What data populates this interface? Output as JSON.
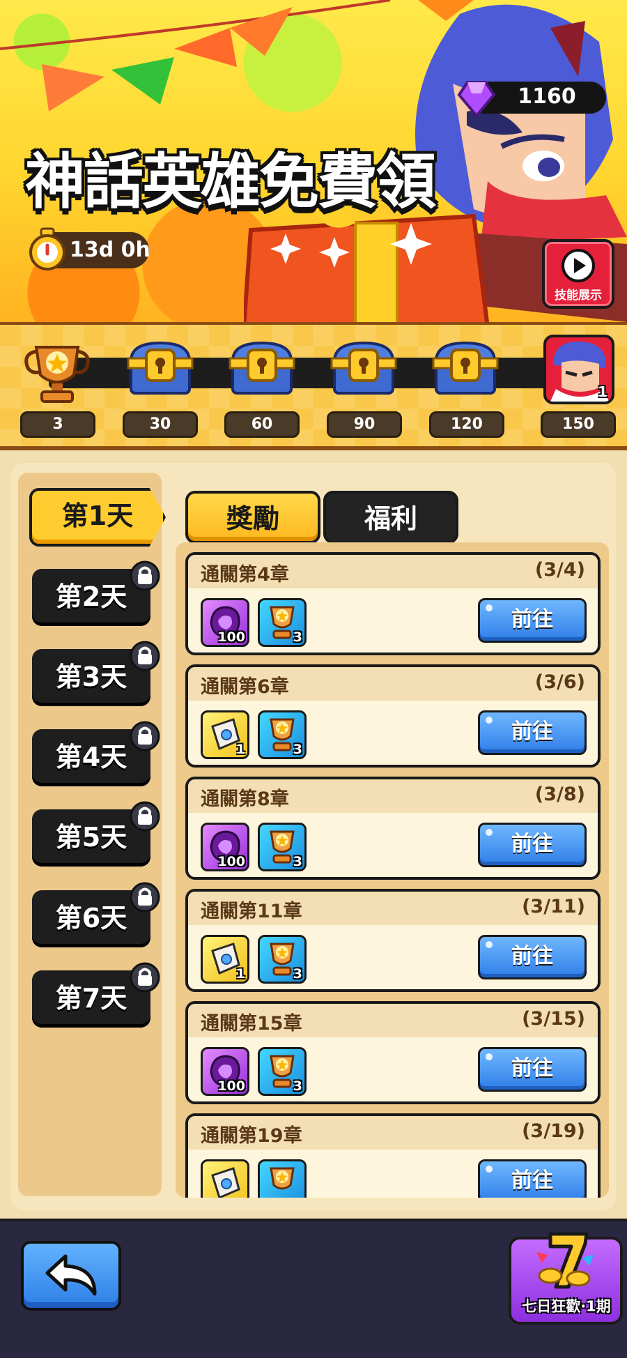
{
  "header": {
    "title": "神話英雄免費領",
    "gems": "1160",
    "timer": "13d 0h",
    "skill_button_label": "技能展示"
  },
  "progress": {
    "milestones": [
      {
        "value": "3",
        "icon": "trophy-icon"
      },
      {
        "value": "30",
        "icon": "chest-icon"
      },
      {
        "value": "60",
        "icon": "chest-icon"
      },
      {
        "value": "90",
        "icon": "chest-icon"
      },
      {
        "value": "120",
        "icon": "chest-icon"
      },
      {
        "value": "150",
        "icon": "hero-portrait-icon",
        "badge": "1"
      }
    ]
  },
  "days": [
    {
      "label": "第1天",
      "active": true,
      "locked": false
    },
    {
      "label": "第2天",
      "active": false,
      "locked": true
    },
    {
      "label": "第3天",
      "active": false,
      "locked": true
    },
    {
      "label": "第4天",
      "active": false,
      "locked": true
    },
    {
      "label": "第5天",
      "active": false,
      "locked": true
    },
    {
      "label": "第6天",
      "active": false,
      "locked": true
    },
    {
      "label": "第7天",
      "active": false,
      "locked": true
    }
  ],
  "tabs": {
    "reward": "獎勵",
    "bonus": "福利"
  },
  "tasks": [
    {
      "title": "通關第4章",
      "progress": "(3/4)",
      "rewards": [
        {
          "type": "purple",
          "icon": "shard-icon",
          "qty": "100"
        },
        {
          "type": "blue",
          "icon": "trophy-icon",
          "qty": "3"
        }
      ],
      "button": "前往"
    },
    {
      "title": "通關第6章",
      "progress": "(3/6)",
      "rewards": [
        {
          "type": "yellow",
          "icon": "scroll-icon",
          "qty": "1"
        },
        {
          "type": "blue",
          "icon": "trophy-icon",
          "qty": "3"
        }
      ],
      "button": "前往"
    },
    {
      "title": "通關第8章",
      "progress": "(3/8)",
      "rewards": [
        {
          "type": "purple",
          "icon": "shard-icon",
          "qty": "100"
        },
        {
          "type": "blue",
          "icon": "trophy-icon",
          "qty": "3"
        }
      ],
      "button": "前往"
    },
    {
      "title": "通關第11章",
      "progress": "(3/11)",
      "rewards": [
        {
          "type": "yellow",
          "icon": "scroll-icon",
          "qty": "1"
        },
        {
          "type": "blue",
          "icon": "trophy-icon",
          "qty": "3"
        }
      ],
      "button": "前往"
    },
    {
      "title": "通關第15章",
      "progress": "(3/15)",
      "rewards": [
        {
          "type": "purple",
          "icon": "shard-icon",
          "qty": "100"
        },
        {
          "type": "blue",
          "icon": "trophy-icon",
          "qty": "3"
        }
      ],
      "button": "前往"
    },
    {
      "title": "通關第19章",
      "progress": "(3/19)",
      "rewards": [
        {
          "type": "yellow",
          "icon": "scroll-icon",
          "qty": ""
        },
        {
          "type": "blue",
          "icon": "trophy-icon",
          "qty": ""
        }
      ],
      "button": "前往"
    }
  ],
  "footer": {
    "event_label": "七日狂歡·1期",
    "event_badge": "7"
  },
  "colors": {
    "accent_yellow": "#ffcc2f",
    "button_blue": "#2f7ee8",
    "panel": "#f7e6bd",
    "dark": "#1e1e1e"
  }
}
